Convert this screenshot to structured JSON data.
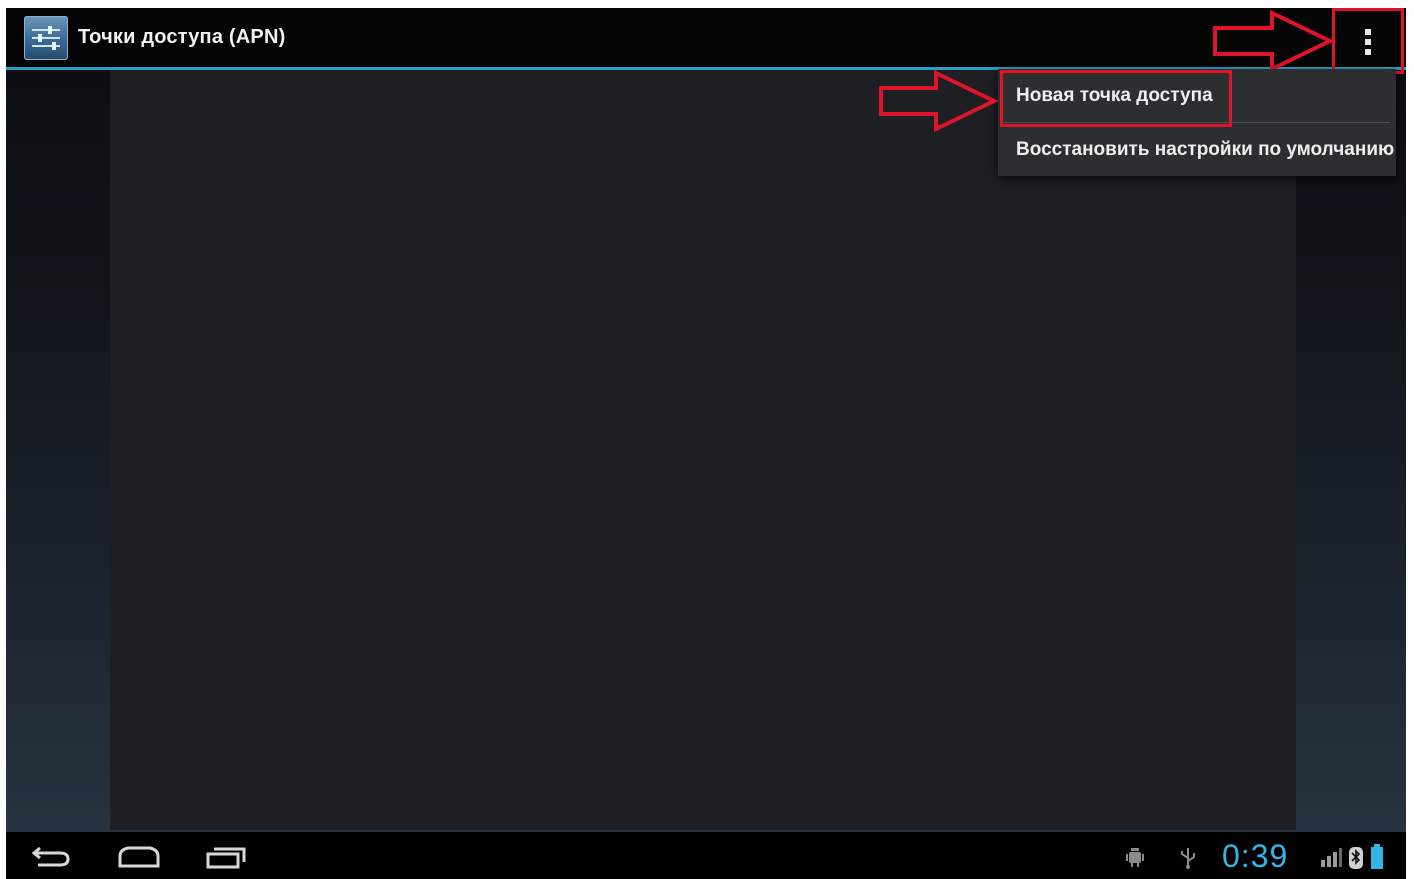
{
  "action_bar": {
    "title": "Точки доступа (APN)",
    "app_icon": "settings-icon",
    "overflow_icon": "overflow-menu-icon",
    "accent_color": "#2d9ec4"
  },
  "menu": {
    "items": [
      {
        "label": "Новая точка доступа"
      },
      {
        "label": "Восстановить настройки по умолчанию"
      }
    ]
  },
  "annotations": {
    "highlight_color": "#e01428",
    "arrow_icon": "red-arrow-icon"
  },
  "system_bar": {
    "clock": "0:39",
    "clock_color": "#33b5e5",
    "nav_icons": [
      "back-icon",
      "home-icon",
      "recent-apps-icon"
    ],
    "status_icons": [
      "android-debug-icon",
      "usb-icon",
      "signal-icon",
      "bluetooth-icon",
      "battery-icon"
    ]
  }
}
